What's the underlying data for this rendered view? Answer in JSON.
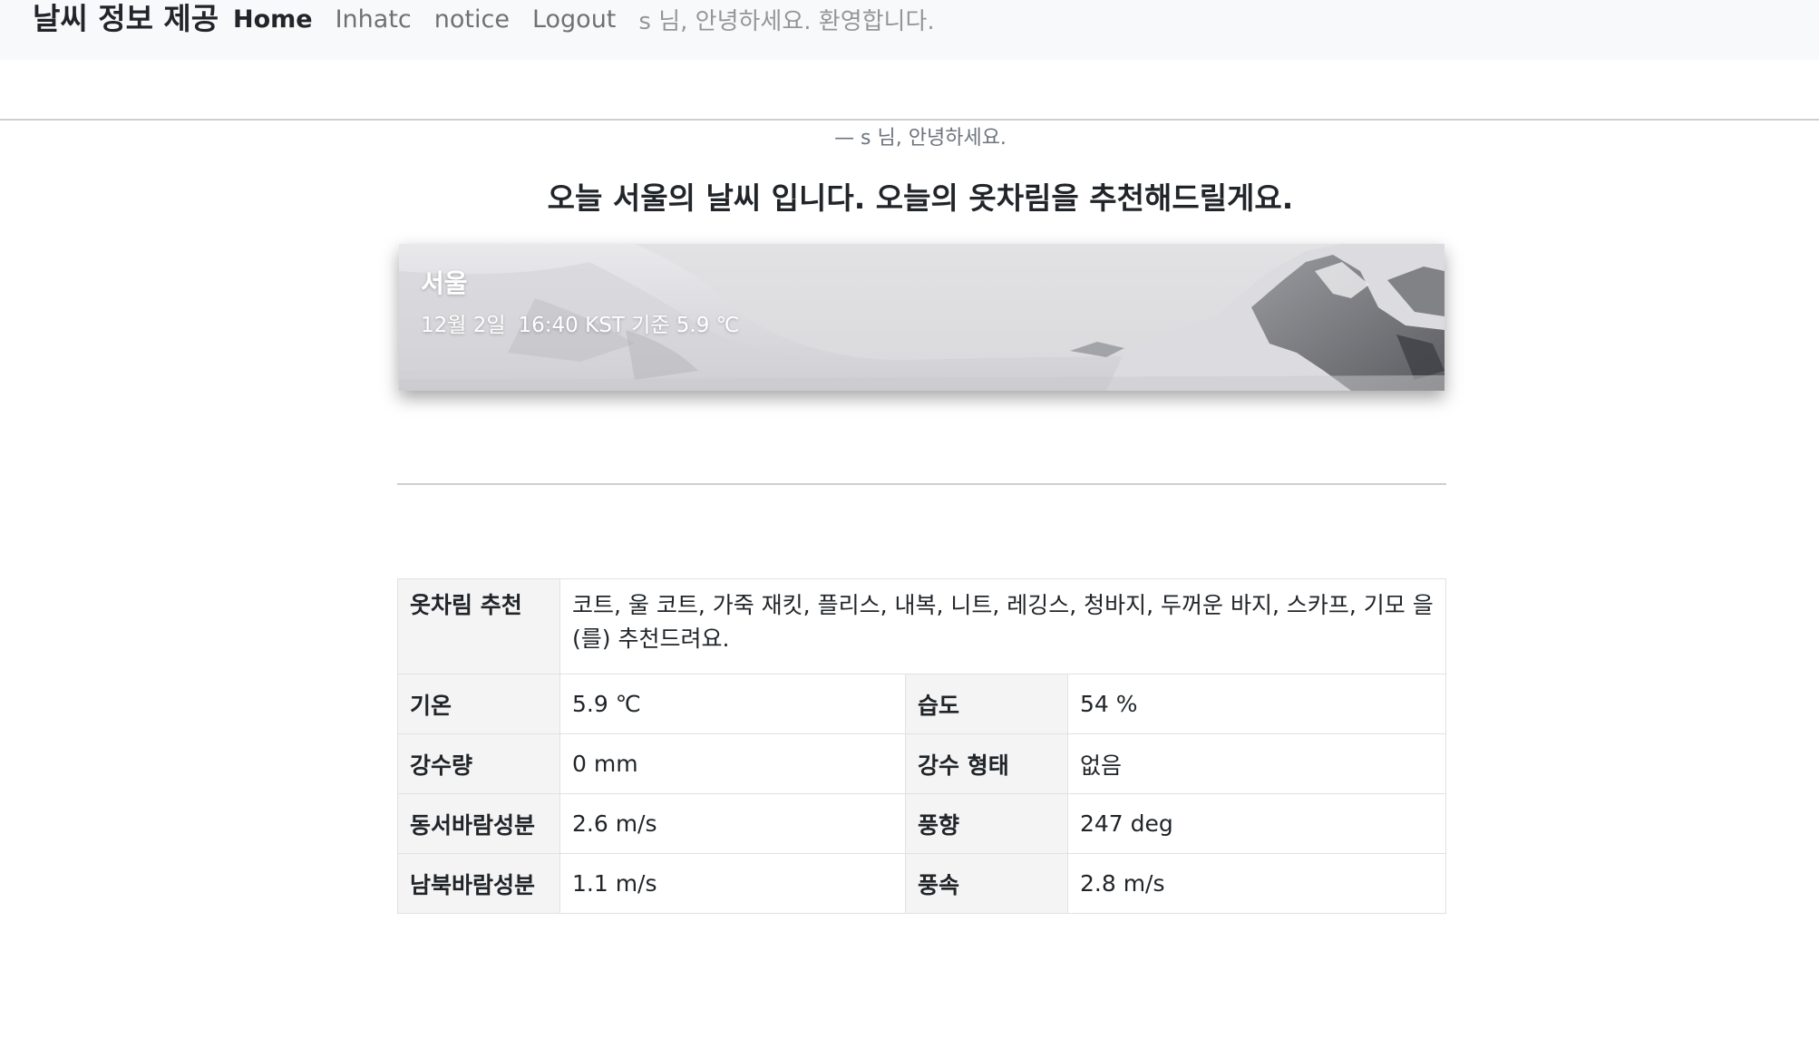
{
  "navbar": {
    "brand": "날씨 정보 제공",
    "links": [
      "Home",
      "Inhatc",
      "notice",
      "Logout"
    ],
    "greeting": "s 님, 안녕하세요. 환영합니다."
  },
  "subtitle": "— s 님, 안녕하세요.",
  "headline": "오늘 서울의 날씨 입니다. 오늘의 옷차림을 추천해드릴게요.",
  "card": {
    "city": "서울",
    "date": "12월 2일",
    "time_info": "16:40 KST 기준 5.9 ℃"
  },
  "table": {
    "recommendation_label": "옷차림 추천",
    "recommendation_value": "코트, 울 코트, 가죽 재킷, 플리스, 내복, 니트, 레깅스, 청바지, 두꺼운 바지, 스카프, 기모 을(를) 추천드려요.",
    "rows": [
      {
        "label1": "기온",
        "value1": "5.9 ℃",
        "label2": "습도",
        "value2": "54 %"
      },
      {
        "label1": "강수량",
        "value1": "0 mm",
        "label2": "강수 형태",
        "value2": "없음"
      },
      {
        "label1": "동서바람성분",
        "value1": "2.6 m/s",
        "label2": "풍향",
        "value2": "247 deg"
      },
      {
        "label1": "남북바람성분",
        "value1": "1.1 m/s",
        "label2": "풍속",
        "value2": "2.8 m/s"
      }
    ]
  },
  "colors": {
    "navbar_bg": "#f8f9fa",
    "muted_text": "#6c757d",
    "table_label_bg": "#f4f4f4",
    "border": "#dee2e6"
  }
}
